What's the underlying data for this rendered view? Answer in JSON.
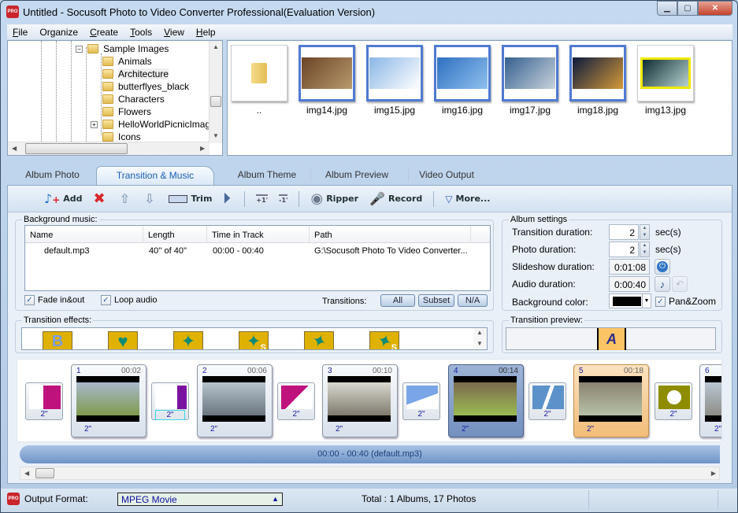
{
  "window": {
    "title": "Untitled - Socusoft Photo to Video Converter Professional(Evaluation Version)",
    "app_icon_text": "PRO",
    "controls": [
      "minimize",
      "maximize",
      "close"
    ]
  },
  "menu": [
    {
      "label": "File",
      "mnemonic": "F",
      "rest": "ile"
    },
    {
      "label": "Organize",
      "mnemonic": "",
      "rest": "Organize"
    },
    {
      "label": "Create",
      "mnemonic": "C",
      "rest": "reate"
    },
    {
      "label": "Tools",
      "mnemonic": "T",
      "rest": "ools"
    },
    {
      "label": "View",
      "mnemonic": "V",
      "rest": "iew"
    },
    {
      "label": "Help",
      "mnemonic": "H",
      "rest": "elp"
    }
  ],
  "folder_tree": {
    "parent": "Sample Images",
    "children": [
      "Animals",
      "Architecture",
      "butterflyes_black",
      "Characters",
      "Flowers",
      "HelloWorldPicnicImage",
      "Icons"
    ],
    "highlighted": "Architecture",
    "expandable": "HelloWorldPicnicImage"
  },
  "gallery": {
    "items": [
      {
        "name": "..",
        "type": "folder",
        "selected": false
      },
      {
        "name": "img14.jpg",
        "type": "image",
        "selected": true,
        "colors": [
          "#6b4426",
          "#b89a6e"
        ]
      },
      {
        "name": "img15.jpg",
        "type": "image",
        "selected": true,
        "colors": [
          "#8ab6e6",
          "#ffffff"
        ]
      },
      {
        "name": "img16.jpg",
        "type": "image",
        "selected": true,
        "colors": [
          "#2e6fc0",
          "#8fc1ee"
        ]
      },
      {
        "name": "img17.jpg",
        "type": "image",
        "selected": true,
        "colors": [
          "#35608f",
          "#c9d3dc"
        ]
      },
      {
        "name": "img18.jpg",
        "type": "image",
        "selected": true,
        "colors": [
          "#0b1a3c",
          "#d69a3a"
        ]
      },
      {
        "name": "img13.jpg",
        "type": "image",
        "selected": false,
        "colors": [
          "#0e2d33",
          "#b7d2cf"
        ]
      }
    ]
  },
  "tabs": [
    {
      "label": "Album Photo",
      "active": false
    },
    {
      "label": "Transition & Music",
      "active": true
    },
    {
      "label": "Album Theme",
      "active": false
    },
    {
      "label": "Album Preview",
      "active": false
    },
    {
      "label": "Video Output",
      "active": false
    }
  ],
  "toolbar": {
    "add": "Add",
    "trim": "Trim",
    "ripper": "Ripper",
    "record": "Record",
    "more": "More...",
    "plus_label": "+1'",
    "minus_label": "-1'"
  },
  "background_music": {
    "title": "Background music:",
    "columns": [
      "Name",
      "Length",
      "Time in Track",
      "Path"
    ],
    "rows": [
      {
        "name": "default.mp3",
        "length": "40'' of 40''",
        "time_in_track": "00:00 - 00:40",
        "path": "G:\\Socusoft Photo To Video Converter..."
      }
    ],
    "fade_label": "Fade in&out",
    "fade_checked": true,
    "loop_label": "Loop audio",
    "loop_checked": true,
    "transitions_label": "Transitions:",
    "transition_buttons": [
      "All",
      "Subset",
      "N/A"
    ]
  },
  "album_settings": {
    "title": "Album settings",
    "transition_duration_label": "Transition duration:",
    "transition_duration": "2",
    "photo_duration_label": "Photo duration:",
    "photo_duration": "2",
    "unit": "sec(s)",
    "slideshow_duration_label": "Slideshow duration:",
    "slideshow_duration": "0:01:08",
    "audio_duration_label": "Audio duration:",
    "audio_duration": "0:00:40",
    "background_color_label": "Background color:",
    "background_color": "#000000",
    "panzoom_label": "Pan&Zoom",
    "panzoom_checked": true
  },
  "transition_effects": {
    "title": "Transition effects:",
    "items": [
      "B",
      "heart",
      "star",
      "star-s",
      "star-rot",
      "star-rot-s"
    ]
  },
  "transition_preview": {
    "title": "Transition preview:",
    "letter": "A"
  },
  "storyboard": {
    "slides": [
      {
        "num": "1",
        "time": "00:02",
        "dur": "2\"",
        "state": "normal",
        "colors": [
          "#a9b9cc",
          "#7f9a4c"
        ]
      },
      {
        "num": "2",
        "time": "00:06",
        "dur": "2\"",
        "state": "normal",
        "colors": [
          "#b6c3cc",
          "#6a7580"
        ]
      },
      {
        "num": "3",
        "time": "00:10",
        "dur": "2\"",
        "state": "normal",
        "colors": [
          "#d9d8d0",
          "#7f7a6e"
        ]
      },
      {
        "num": "4",
        "time": "00:14",
        "dur": "2\"",
        "state": "selected",
        "colors": [
          "#7a6a4e",
          "#9bbb52"
        ]
      },
      {
        "num": "5",
        "time": "00:18",
        "dur": "2\"",
        "state": "current",
        "colors": [
          "#8a8370",
          "#b7c1a8"
        ]
      },
      {
        "num": "6",
        "time": "",
        "dur": "2\"",
        "state": "normal",
        "colors": [
          "#b9c6d3",
          "#8d8d86"
        ]
      }
    ],
    "transitions": [
      {
        "dur": "2\"",
        "kind": "push-s",
        "colors": [
          "#c0127c",
          "#ffffff"
        ]
      },
      {
        "dur": "2\"",
        "kind": "hand",
        "colors": [
          "#ffffff",
          "#7b13a2"
        ]
      },
      {
        "dur": "2\"",
        "kind": "arrow",
        "colors": [
          "#c0127c",
          "#ffffff"
        ]
      },
      {
        "dur": "2\"",
        "kind": "wedge",
        "colors": [
          "#7aa6e8",
          "#ffffff"
        ]
      },
      {
        "dur": "2\"",
        "kind": "split-2",
        "colors": [
          "#5b92c9",
          "#ffffff"
        ]
      },
      {
        "dur": "2\"",
        "kind": "pentagon",
        "colors": [
          "#8e8d00",
          "#ffffff"
        ]
      }
    ],
    "audio_track": "00:00 - 00:40 (default.mp3)"
  },
  "status": {
    "output_format_label": "Output Format:",
    "output_format": "MPEG Movie",
    "total": "Total : 1 Albums, 17 Photos"
  }
}
